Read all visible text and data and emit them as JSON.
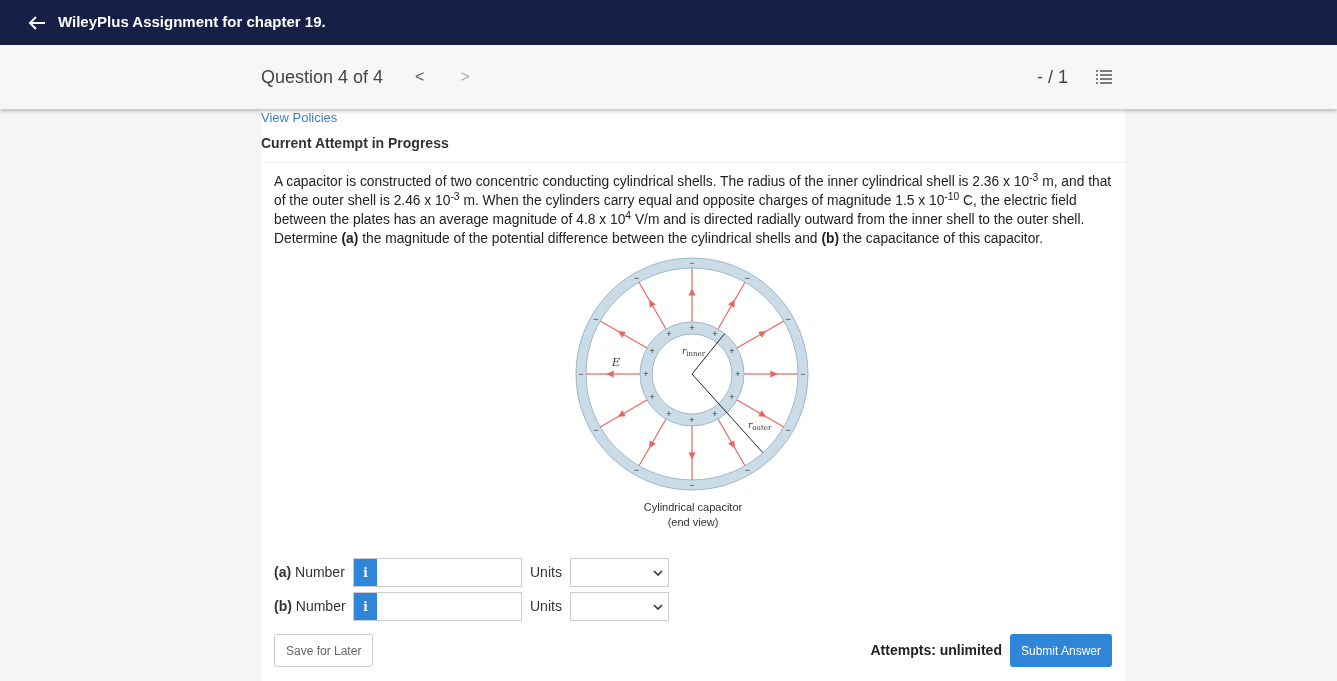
{
  "header": {
    "title": "WileyPlus Assignment for chapter 19."
  },
  "question_nav": {
    "label": "Question 4 of 4",
    "prev": "<",
    "next": ">",
    "score": "- / 1"
  },
  "policies_link": "View Policies",
  "attempt_heading": "Current Attempt in Progress",
  "question_text": "A capacitor is constructed of two concentric conducting cylindrical shells. The radius of the inner cylindrical shell is 2.36 x 10$^{-3}$ m, and that of the outer shell is 2.46 x 10$^{-3}$ m. When the cylinders carry equal and opposite charges of magnitude 1.5 x 10$^{-10}$ C, the electric field between the plates has an average magnitude of 4.8 x 10$^{4}$ V/m and is directed radially outward from the inner shell to the outer shell. Determine **(a)** the magnitude of the potential difference between the cylindrical shells and **(b)** the capacitance of this capacitor.",
  "figure": {
    "field_label": "E",
    "inner_radius_label": "r",
    "inner_radius_sub": "inner",
    "outer_radius_label": "r",
    "outer_radius_sub": "outer",
    "inner_signs": [
      "+",
      "+",
      "+",
      "+",
      "+",
      "+",
      "+",
      "+",
      "+",
      "+",
      "+",
      "+"
    ],
    "outer_signs": [
      "−",
      "−",
      "−",
      "−",
      "−",
      "−",
      "−",
      "−",
      "−",
      "−",
      "−",
      "−"
    ],
    "caption": [
      "Cylindrical capacitor",
      "(end view)"
    ]
  },
  "answers": [
    {
      "label": "**(a)** Number",
      "info": "i",
      "units_label": "Units"
    },
    {
      "label": "**(b)** Number",
      "info": "i",
      "units_label": "Units"
    }
  ],
  "save_button": "Save for Later",
  "attempts": "Attempts: unlimited",
  "submit_button": "Submit Answer"
}
